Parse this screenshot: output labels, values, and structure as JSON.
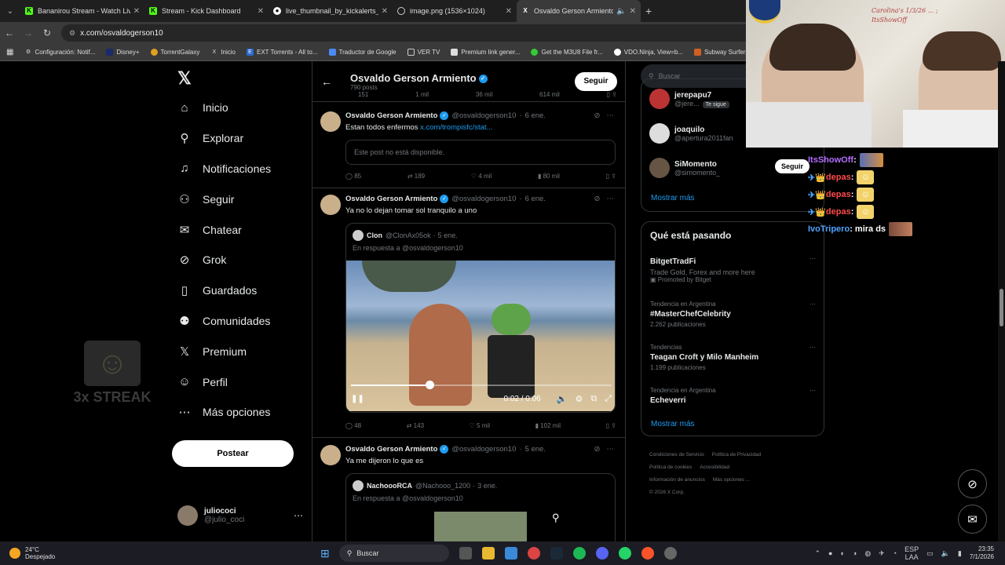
{
  "browser": {
    "tabs": [
      {
        "title": "Bananirou Stream - Watch Live",
        "icon": "K",
        "color": "#53fc18"
      },
      {
        "title": "Stream - Kick Dashboard",
        "icon": "K",
        "color": "#53fc18"
      },
      {
        "title": "live_thumbnail_by_kickalerts_ju",
        "icon": "github-icon",
        "color": "#ffffff"
      },
      {
        "title": "image.png (1536×1024)",
        "icon": "globe-icon",
        "color": "#cccccc"
      },
      {
        "title": "Osvaldo Gerson Armiento (",
        "icon": "X",
        "color": "#ffffff"
      }
    ],
    "url": "x.com/osvaldogerson10",
    "bookmarks": [
      "Configuración: Notif...",
      "Disney+",
      "TorrentGalaxy",
      "Inicio",
      "EXT Torrents - All to...",
      "Traductor de Google",
      "VER TV",
      "Premium link gener...",
      "Get the M3U8 File fr...",
      "VDO.Ninja, View=b...",
      "Subway Surfers W"
    ]
  },
  "nav": {
    "items": [
      "Inicio",
      "Explorar",
      "Notificaciones",
      "Seguir",
      "Chatear",
      "Grok",
      "Guardados",
      "Comunidades",
      "Premium",
      "Perfil",
      "Más opciones"
    ],
    "post_button": "Postear"
  },
  "me": {
    "name": "juliococi",
    "handle": "@julio_coci"
  },
  "overlay": {
    "streak": "3x STREAK"
  },
  "profile": {
    "name": "Osvaldo Gerson Armiento",
    "posts": "790 posts",
    "follow": "Seguir"
  },
  "top_actions": [
    "151",
    "1 mil",
    "36 mil",
    "614 mil"
  ],
  "posts": [
    {
      "name": "Osvaldo Gerson Armiento",
      "handle": "@osvaldogerson10",
      "date": "6 ene.",
      "text": "Estan todos enfermos ",
      "link": "x.com/trompisfc/stat...",
      "unavailable": "Este post no está disponible.",
      "replies": "85",
      "reposts": "189",
      "likes": "4 mil",
      "views": "80 mil"
    },
    {
      "name": "Osvaldo Gerson Armiento",
      "handle": "@osvaldogerson10",
      "date": "6 ene.",
      "text": "Ya no lo dejan tomar sol tranquilo a uno",
      "quote": {
        "name": "Clon",
        "handle": "@ClonAx05ok",
        "date": "5 ene.",
        "reply": "En respuesta a @osvaldogerson10"
      },
      "video": {
        "time": "0:02 / 0:06",
        "progress": 0.3
      },
      "replies": "48",
      "reposts": "143",
      "likes": "5 mil",
      "views": "102 mil"
    },
    {
      "name": "Osvaldo Gerson Armiento",
      "handle": "@osvaldogerson10",
      "date": "5 ene.",
      "text": "Ya me dijeron lo que es",
      "quote": {
        "name": "NachoooRCA",
        "handle": "@Nachooo_1200",
        "date": "3 ene.",
        "reply": "En respuesta a @osvaldogerson10"
      }
    }
  ],
  "search": {
    "placeholder": "Buscar"
  },
  "who_to_follow": [
    {
      "name": "jerepapu7",
      "handle": "@jere...",
      "badge": "Te sigue"
    },
    {
      "name": "joaquilo",
      "handle": "@apertura2011fan"
    },
    {
      "name": "SiMomento",
      "handle": "@simomento_",
      "button": "Seguir"
    }
  ],
  "more": "Mostrar más",
  "trends": {
    "title": "Qué está pasando",
    "items": [
      {
        "context": "",
        "name": "BitgetTradFi",
        "sub": "Trade Gold, Forex and more here",
        "meta": "Promoted by Bitget"
      },
      {
        "context": "Tendencia en Argentina",
        "name": "#MasterChefCelebrity",
        "meta": "2.262 publicaciones"
      },
      {
        "context": "Tendencias",
        "name": "Teagan Croft y Milo Manheim",
        "meta": "1.199 publicaciones"
      },
      {
        "context": "Tendencia en Argentina",
        "name": "Echeverri",
        "meta": ""
      }
    ],
    "more": "Mostrar más"
  },
  "footer": [
    "Condiciones de Servicio",
    "Política de Privacidad",
    "Política de cookies",
    "Accesibilidad",
    "Información de anuncios",
    "Más opciones ...",
    "© 2026 X Corp."
  ],
  "webcam": {
    "whiteboard": "Carolina's 1/3/26 ... ; ItsShowOff"
  },
  "chat": [
    {
      "user": "ItsShowOff",
      "msg": ":"
    },
    {
      "user": "depas",
      "msg": ":"
    },
    {
      "user": "depas",
      "msg": ":"
    },
    {
      "user": "depas",
      "msg": ":"
    },
    {
      "user": "IvoTripero",
      "msg": ": mira ds"
    }
  ],
  "taskbar": {
    "temp": "24°C",
    "weather": "Despejado",
    "search": "Buscar",
    "lang": "ESP",
    "lang2": "LAA",
    "time": "23:35",
    "date": "7/1/2026"
  }
}
